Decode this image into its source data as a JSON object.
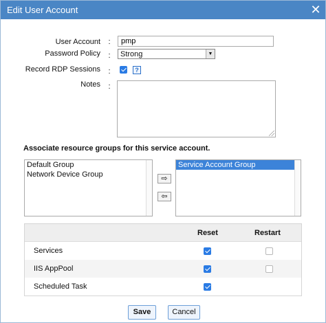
{
  "window": {
    "title": "Edit User Account",
    "close_glyph": "✕"
  },
  "form": {
    "user_account_label": "User Account",
    "user_account_value": "pmp",
    "password_policy_label": "Password Policy",
    "password_policy_value": "Strong",
    "record_rdp_label": "Record RDP Sessions",
    "record_rdp_checked": true,
    "help_glyph": "?",
    "notes_label": "Notes",
    "notes_value": "",
    "colon": ":"
  },
  "groups": {
    "title": "Associate resource groups for this service account.",
    "available": [
      "Default Group",
      "Network Device Group"
    ],
    "selected": [
      "Service Account Group"
    ],
    "move_right_glyph": "⇨",
    "move_left_glyph": "⇦"
  },
  "actions_table": {
    "headers": [
      "",
      "Reset",
      "Restart"
    ],
    "rows": [
      {
        "name": "Services",
        "reset": true,
        "restart": false
      },
      {
        "name": "IIS AppPool",
        "reset": true,
        "restart": false
      },
      {
        "name": "Scheduled Task",
        "reset": true,
        "restart": null
      }
    ]
  },
  "buttons": {
    "save": "Save",
    "cancel": "Cancel"
  },
  "colors": {
    "titlebar": "#4a86c5",
    "selection": "#3c83d9",
    "checkbox": "#2a7be4"
  }
}
